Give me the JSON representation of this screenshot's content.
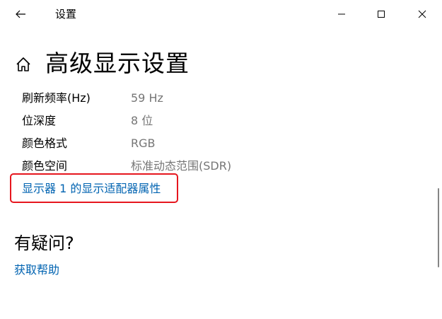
{
  "window": {
    "title": "设置"
  },
  "page": {
    "title": "高级显示设置"
  },
  "properties": [
    {
      "label": "刷新频率(Hz)",
      "value": "59 Hz"
    },
    {
      "label": "位深度",
      "value": "8 位"
    },
    {
      "label": "颜色格式",
      "value": "RGB"
    },
    {
      "label": "颜色空间",
      "value": "标准动态范围(SDR)"
    }
  ],
  "adapter_link": "显示器 1 的显示适配器属性",
  "help": {
    "heading": "有疑问?",
    "link": "获取帮助"
  },
  "colors": {
    "link": "#0063b1",
    "highlight": "#e6161e",
    "secondary_text": "#767676"
  },
  "icons": {
    "back": "back-arrow-icon",
    "minimize": "minimize-icon",
    "maximize": "maximize-icon",
    "close": "close-icon",
    "home": "home-icon"
  }
}
